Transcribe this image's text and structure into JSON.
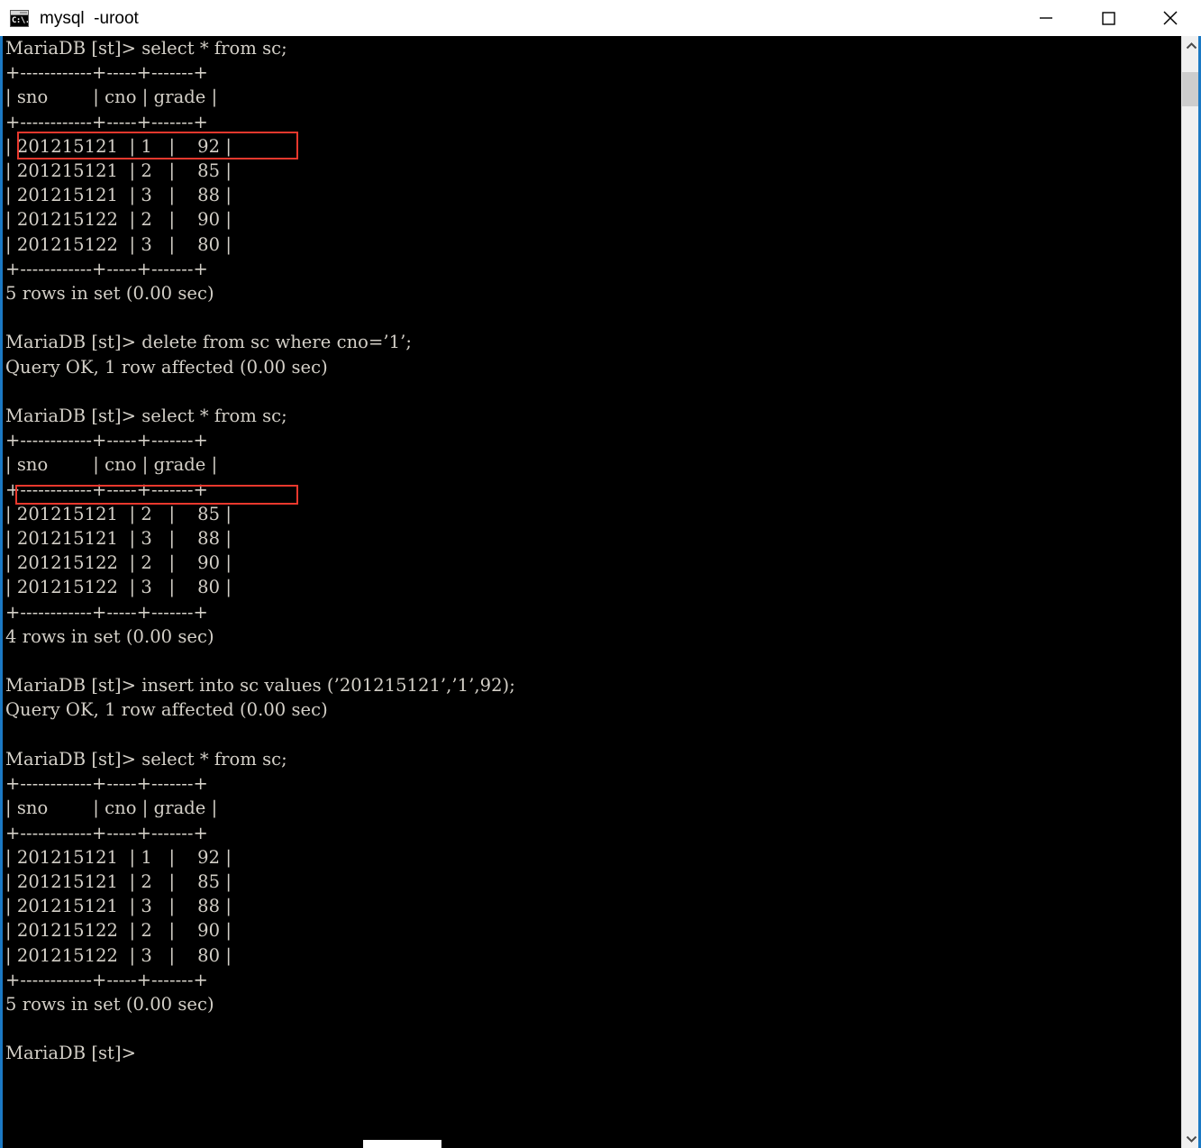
{
  "window": {
    "title": "mysql  -uroot",
    "icon": "command-prompt-icon",
    "icon_glyph": "C:\\.",
    "controls": {
      "minimize_label": "Minimize",
      "maximize_label": "Maximize",
      "close_label": "Close"
    }
  },
  "colors": {
    "terminal_background": "#000000",
    "terminal_text": "#d4d0c8",
    "annotation_red": "#e8382d",
    "window_accent_blue": "#1b79c4",
    "titlebar_background": "#ffffff",
    "scrollbar_track": "#f0f0f0",
    "scrollbar_thumb": "#cdcdcd"
  },
  "terminal": {
    "prompt": "MariaDB [st]>",
    "database": "st",
    "content": "MariaDB [st]> select * from sc;\n+------------+-----+-------+\n| sno        | cno | grade |\n+------------+-----+-------+\n| 201215121  | 1   |    92 |\n| 201215121  | 2   |    85 |\n| 201215121  | 3   |    88 |\n| 201215122  | 2   |    90 |\n| 201215122  | 3   |    80 |\n+------------+-----+-------+\n5 rows in set (0.00 sec)\n\nMariaDB [st]> delete from sc where cno=’1’;\nQuery OK, 1 row affected (0.00 sec)\n\nMariaDB [st]> select * from sc;\n+------------+-----+-------+\n| sno        | cno | grade |\n+------------+-----+-------+\n| 201215121  | 2   |    85 |\n| 201215121  | 3   |    88 |\n| 201215122  | 2   |    90 |\n| 201215122  | 3   |    80 |\n+------------+-----+-------+\n4 rows in set (0.00 sec)\n\nMariaDB [st]> insert into sc values (’201215121’,’1’,92);\nQuery OK, 1 row affected (0.00 sec)\n\nMariaDB [st]> select * from sc;\n+------------+-----+-------+\n| sno        | cno | grade |\n+------------+-----+-------+\n| 201215121  | 1   |    92 |\n| 201215121  | 2   |    85 |\n| 201215121  | 3   |    88 |\n| 201215122  | 2   |    90 |\n| 201215122  | 3   |    80 |\n+------------+-----+-------+\n5 rows in set (0.00 sec)\n\nMariaDB [st]>",
    "commands": [
      {
        "index": 1,
        "prompt": "MariaDB [st]>",
        "sql": "select * from sc;",
        "result_status": "5 rows in set (0.00 sec)",
        "table": {
          "columns": [
            "sno",
            "cno",
            "grade"
          ],
          "rows": [
            [
              "201215121",
              "1",
              "92"
            ],
            [
              "201215121",
              "2",
              "85"
            ],
            [
              "201215121",
              "3",
              "88"
            ],
            [
              "201215122",
              "2",
              "90"
            ],
            [
              "201215122",
              "3",
              "80"
            ]
          ]
        }
      },
      {
        "index": 2,
        "prompt": "MariaDB [st]>",
        "sql": "delete from sc where cno=’1’;",
        "result_status": "Query OK, 1 row affected (0.00 sec)",
        "table": null
      },
      {
        "index": 3,
        "prompt": "MariaDB [st]>",
        "sql": "select * from sc;",
        "result_status": "4 rows in set (0.00 sec)",
        "table": {
          "columns": [
            "sno",
            "cno",
            "grade"
          ],
          "rows": [
            [
              "201215121",
              "2",
              "85"
            ],
            [
              "201215121",
              "3",
              "88"
            ],
            [
              "201215122",
              "2",
              "90"
            ],
            [
              "201215122",
              "3",
              "80"
            ]
          ]
        }
      },
      {
        "index": 4,
        "prompt": "MariaDB [st]>",
        "sql": "insert into sc values (’201215121’,’1’,92);",
        "result_status": "Query OK, 1 row affected (0.00 sec)",
        "table": null
      },
      {
        "index": 5,
        "prompt": "MariaDB [st]>",
        "sql": "select * from sc;",
        "result_status": "5 rows in set (0.00 sec)",
        "table": {
          "columns": [
            "sno",
            "cno",
            "grade"
          ],
          "rows": [
            [
              "201215121",
              "1",
              "92"
            ],
            [
              "201215121",
              "2",
              "85"
            ],
            [
              "201215121",
              "3",
              "88"
            ],
            [
              "201215122",
              "2",
              "90"
            ],
            [
              "201215122",
              "3",
              "80"
            ]
          ]
        }
      }
    ],
    "final_prompt": "MariaDB [st]>"
  },
  "annotations": [
    {
      "name": "row-to-be-deleted",
      "target_row": [
        "201215121",
        "1",
        "92"
      ],
      "color": "#e8382d"
    },
    {
      "name": "deleted-row-gap",
      "target_row": null,
      "color": "#e8382d"
    }
  ],
  "scrollbars": {
    "vertical": {
      "up_arrow": "chevron-up-icon",
      "down_arrow": "chevron-down-icon",
      "thumb_position_pct": 3
    },
    "horizontal": {
      "visible": true
    }
  }
}
